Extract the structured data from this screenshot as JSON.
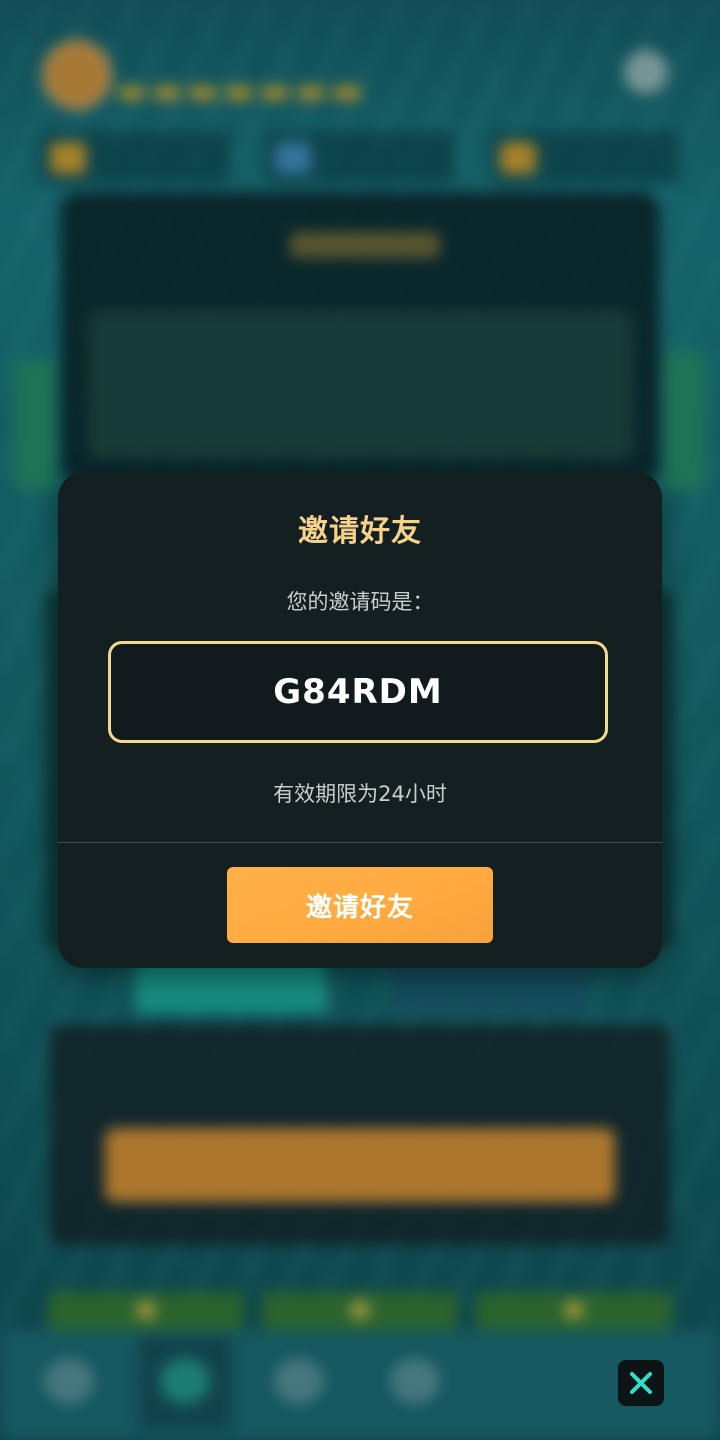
{
  "dialog": {
    "title": "邀请好友",
    "subtitle": "您的邀请码是：",
    "invite_code": "G84RDM",
    "validity": "有效期限为24小时",
    "button_label": "邀请好友"
  },
  "close_button": {
    "icon": "close-icon"
  },
  "colors": {
    "title": "#f5d28a",
    "code_border": "#f4d98a",
    "button": "#ffab40",
    "close_x": "#2fe0c8",
    "dialog_bg": "#141f22"
  }
}
